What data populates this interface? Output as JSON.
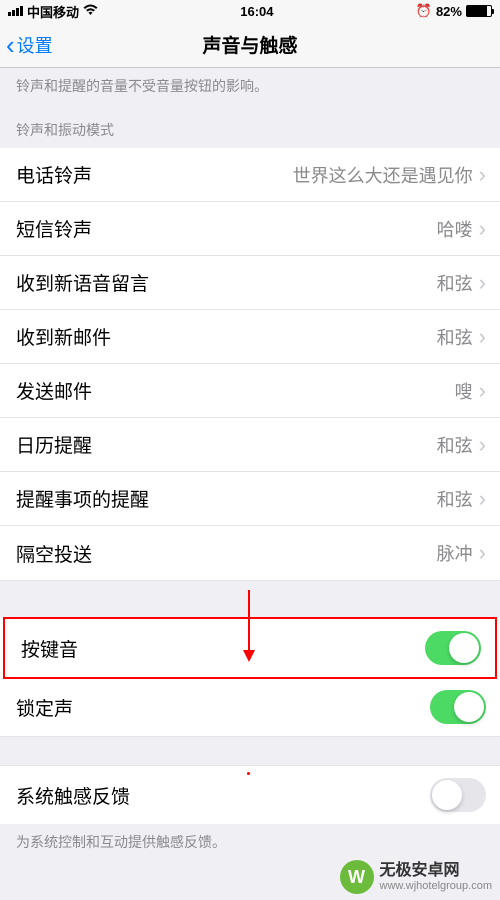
{
  "status": {
    "carrier": "中国移动",
    "time": "16:04",
    "battery_pct": "82%"
  },
  "nav": {
    "back_label": "设置",
    "title": "声音与触感"
  },
  "top_desc": "铃声和提醒的音量不受音量按钮的影响。",
  "section1_header": "铃声和振动模式",
  "rows": [
    {
      "label": "电话铃声",
      "value": "世界这么大还是遇见你"
    },
    {
      "label": "短信铃声",
      "value": "哈喽"
    },
    {
      "label": "收到新语音留言",
      "value": "和弦"
    },
    {
      "label": "收到新邮件",
      "value": "和弦"
    },
    {
      "label": "发送邮件",
      "value": "嗖"
    },
    {
      "label": "日历提醒",
      "value": "和弦"
    },
    {
      "label": "提醒事项的提醒",
      "value": "和弦"
    },
    {
      "label": "隔空投送",
      "value": "脉冲"
    }
  ],
  "toggles": {
    "keypress": {
      "label": "按键音",
      "on": true
    },
    "lock": {
      "label": "锁定声",
      "on": true
    },
    "haptic": {
      "label": "系统触感反馈",
      "on": false
    }
  },
  "footer_desc": "为系统控制和互动提供触感反馈。",
  "watermark": {
    "title": "无极安卓网",
    "url": "www.wjhotelgroup.com"
  }
}
